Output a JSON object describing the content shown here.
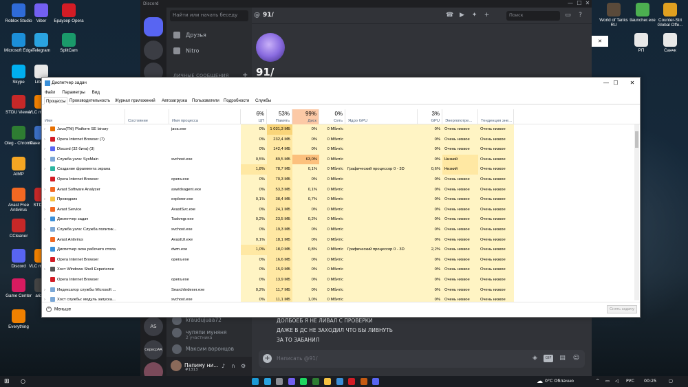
{
  "desktop": {
    "left_icons": [
      {
        "label": "Roblox Studio",
        "color": "#2f6bd8"
      },
      {
        "label": "Viber",
        "color": "#7360f2"
      },
      {
        "label": "Браузер Opera",
        "color": "#d31c25"
      },
      {
        "label": "Microsoft Edge",
        "color": "#1c8fd8"
      },
      {
        "label": "Telegram",
        "color": "#2aa3e0"
      },
      {
        "label": "SplitCam",
        "color": "#1a9a6a"
      },
      {
        "label": "Skype",
        "color": "#00aff0"
      },
      {
        "label": "LibreO",
        "color": "#e8e8e8"
      },
      {
        "label": "STDU Viewer",
        "color": "#c62828"
      },
      {
        "label": "VLC m playe",
        "color": "#f08000"
      },
      {
        "label": "Oleg - Chrome",
        "color": "#2e7d32"
      },
      {
        "label": "Пане управ",
        "color": "#3b6fc4"
      },
      {
        "label": "AIMP",
        "color": "#f5a623"
      },
      {
        "label": "Avast Free Antivirus",
        "color": "#f26822"
      },
      {
        "label": "STDU V",
        "color": "#c62828"
      },
      {
        "label": "CCleaner",
        "color": "#c62828"
      },
      {
        "label": "Discord",
        "color": "#5865f2"
      },
      {
        "label": "VLC m playe",
        "color": "#f08000"
      },
      {
        "label": "Game Center",
        "color": "#d81b60"
      },
      {
        "label": "arizon",
        "color": "#444444"
      },
      {
        "label": "Everything",
        "color": "#f08000"
      }
    ],
    "right_icons": [
      {
        "label": "World of Tanks RU",
        "color": "#5a4a3a"
      },
      {
        "label": "tlauncher.exe",
        "color": "#4caf50"
      },
      {
        "label": "Counter-Stri Global Offe...",
        "color": "#e0a020"
      },
      {
        "label": "РП",
        "color": "#e8e8e8"
      },
      {
        "label": "Санчк",
        "color": "#e8e8e8"
      }
    ],
    "popup_close": "✕"
  },
  "discord": {
    "window_title": "Discord",
    "search_placeholder": "Найти или начать беседу",
    "nav": [
      "Друзья",
      "Nitro"
    ],
    "dm_caption": "ЛИЧНЫЕ СООБЩЕНИЯ",
    "dm_add": "+",
    "servers": [
      "АS",
      "СервсрАА"
    ],
    "dms": [
      {
        "name": "kraudujuaa72",
        "sub": ""
      },
      {
        "name": "чупяпи муняня",
        "sub": "2 участника"
      },
      {
        "name": "Максим воронцов",
        "sub": ""
      }
    ],
    "user": {
      "name": "Папиму ни...",
      "tag": "#1313"
    },
    "channel_name": "91/",
    "big_name": "91/",
    "header_search": "Поиск",
    "messages": [
      "ДОЛБОЕБ Я НЕ ЛИВАЛ С ПРОВЕРКИ",
      "ДАЖЕ В ДС НЕ ЗАХОДИЛ ЧТО БЫ ЛИВНУТЬ",
      "ЗА ТО ЗАБАНИЛ"
    ],
    "input_placeholder": "Написать @91/",
    "gif_label": "GIF"
  },
  "taskmanager": {
    "title": "Диспетчер задач",
    "controls": {
      "min": "—",
      "max": "☐",
      "close": "✕"
    },
    "menu": [
      "Файл",
      "Параметры",
      "Вид"
    ],
    "tabs": [
      "Процессы",
      "Производительность",
      "Журнал приложений",
      "Автозагрузка",
      "Пользователи",
      "Подробности",
      "Службы"
    ],
    "headers": {
      "name": "Имя",
      "status": "Состояние",
      "process": "Имя процесса",
      "cpu_pct": "6%",
      "cpu": "ЦП",
      "mem_pct": "53%",
      "mem": "Память",
      "disk_pct": "99%",
      "disk": "Диск",
      "net_pct": "0%",
      "net": "Сеть",
      "gpu_engine": "Ядро GPU",
      "gpu_pct": "3%",
      "gpu": "GPU",
      "power": "Энергопотре...",
      "power_trend": "Тенденция эне..."
    },
    "rows": [
      {
        "name": "Java(TM) Platform SE binary",
        "proc": "java.exe",
        "cpu": "0%",
        "mem": "1 031,3 МБ",
        "disk": "0%",
        "net": "0 Мбит/с",
        "gpu_engine": "",
        "gpu": "0%",
        "power": "Очень низкое",
        "trend": "Очень низкое",
        "icon": "#e76f00",
        "expand": true
      },
      {
        "name": "Opera Internet Browser (7)",
        "proc": "",
        "cpu": "0%",
        "mem": "232,4 МБ",
        "disk": "0%",
        "net": "0 Мбит/с",
        "gpu_engine": "",
        "gpu": "0%",
        "power": "Очень низкое",
        "trend": "Очень низкое",
        "icon": "#d31c25",
        "expand": true
      },
      {
        "name": "Discord (32 бита) (3)",
        "proc": "",
        "cpu": "0%",
        "mem": "142,4 МБ",
        "disk": "0%",
        "net": "0 Мбит/с",
        "gpu_engine": "",
        "gpu": "0%",
        "power": "Очень низкое",
        "trend": "Очень низкое",
        "icon": "#5865f2",
        "expand": true
      },
      {
        "name": "Служба узла: SysMain",
        "proc": "svchost.exe",
        "cpu": "0,5%",
        "mem": "89,5 МБ",
        "disk": "63,0%",
        "net": "0 Мбит/с",
        "gpu_engine": "",
        "gpu": "0%",
        "power": "Низкий",
        "trend": "Очень низкое",
        "icon": "#7aa7d6",
        "expand": true
      },
      {
        "name": "Создание фрагмента экрана",
        "proc": "",
        "cpu": "1,8%",
        "mem": "78,7 МБ",
        "disk": "0,1%",
        "net": "0 Мбит/с",
        "gpu_engine": "Графический процессор 0 - 3D",
        "gpu": "0,6%",
        "power": "Низкий",
        "trend": "Очень низкое",
        "icon": "#2bb5a0",
        "expand": true
      },
      {
        "name": "Opera Internet Browser",
        "proc": "opera.exe",
        "cpu": "0%",
        "mem": "70,3 МБ",
        "disk": "0%",
        "net": "0 Мбит/с",
        "gpu_engine": "",
        "gpu": "0%",
        "power": "Очень низкое",
        "trend": "Очень низкое",
        "icon": "#d31c25",
        "expand": false
      },
      {
        "name": "Avast Software Analyzer",
        "proc": "aswidsagent.exe",
        "cpu": "0%",
        "mem": "53,3 МБ",
        "disk": "0,1%",
        "net": "0 Мбит/с",
        "gpu_engine": "",
        "gpu": "0%",
        "power": "Очень низкое",
        "trend": "Очень низкое",
        "icon": "#f26822",
        "expand": true
      },
      {
        "name": "Проводник",
        "proc": "explorer.exe",
        "cpu": "0,1%",
        "mem": "38,4 МБ",
        "disk": "0,7%",
        "net": "0 Мбит/с",
        "gpu_engine": "",
        "gpu": "0%",
        "power": "Очень низкое",
        "trend": "Очень низкое",
        "icon": "#f5c242",
        "expand": true
      },
      {
        "name": "Avast Service",
        "proc": "AvastSvc.exe",
        "cpu": "0%",
        "mem": "24,1 МБ",
        "disk": "0%",
        "net": "0 Мбит/с",
        "gpu_engine": "",
        "gpu": "0%",
        "power": "Очень низкое",
        "trend": "Очень низкое",
        "icon": "#f26822",
        "expand": true
      },
      {
        "name": "Диспетчер задач",
        "proc": "Taskmgr.exe",
        "cpu": "0,2%",
        "mem": "23,5 МБ",
        "disk": "0,2%",
        "net": "0 Мбит/с",
        "gpu_engine": "",
        "gpu": "0%",
        "power": "Очень низкое",
        "trend": "Очень низкое",
        "icon": "#3a8fd8",
        "expand": true
      },
      {
        "name": "Служба узла: Служба политик...",
        "proc": "svchost.exe",
        "cpu": "0%",
        "mem": "19,3 МБ",
        "disk": "0%",
        "net": "0 Мбит/с",
        "gpu_engine": "",
        "gpu": "0%",
        "power": "Очень низкое",
        "trend": "Очень низкое",
        "icon": "#7aa7d6",
        "expand": true
      },
      {
        "name": "Avast Antivirus",
        "proc": "AvastUI.exe",
        "cpu": "0,1%",
        "mem": "18,1 МБ",
        "disk": "0%",
        "net": "0 Мбит/с",
        "gpu_engine": "",
        "gpu": "0%",
        "power": "Очень низкое",
        "trend": "Очень низкое",
        "icon": "#f26822",
        "expand": false
      },
      {
        "name": "Диспетчер окон рабочего стола",
        "proc": "dwm.exe",
        "cpu": "1,0%",
        "mem": "18,0 МБ",
        "disk": "0,8%",
        "net": "0 Мбит/с",
        "gpu_engine": "Графический процессор 0 - 3D",
        "gpu": "2,2%",
        "power": "Очень низкое",
        "trend": "Очень низкое",
        "icon": "#3a8fd8",
        "expand": false
      },
      {
        "name": "Opera Internet Browser",
        "proc": "opera.exe",
        "cpu": "0%",
        "mem": "16,6 МБ",
        "disk": "0%",
        "net": "0 Мбит/с",
        "gpu_engine": "",
        "gpu": "0%",
        "power": "Очень низкое",
        "trend": "Очень низкое",
        "icon": "#d31c25",
        "expand": false
      },
      {
        "name": "Хост Windows Shell Experience",
        "proc": "",
        "cpu": "0%",
        "mem": "15,9 МБ",
        "disk": "0%",
        "net": "0 Мбит/с",
        "gpu_engine": "",
        "gpu": "0%",
        "power": "Очень низкое",
        "trend": "Очень низкое",
        "icon": "#555555",
        "expand": true
      },
      {
        "name": "Opera Internet Browser",
        "proc": "opera.exe",
        "cpu": "0%",
        "mem": "13,9 МБ",
        "disk": "0%",
        "net": "0 Мбит/с",
        "gpu_engine": "",
        "gpu": "0%",
        "power": "Очень низкое",
        "trend": "Очень низкое",
        "icon": "#d31c25",
        "expand": false
      },
      {
        "name": "Индексатор службы Microsoft ...",
        "proc": "SearchIndexer.exe",
        "cpu": "0,2%",
        "mem": "11,7 МБ",
        "disk": "0%",
        "net": "0 Мбит/с",
        "gpu_engine": "",
        "gpu": "0%",
        "power": "Очень низкое",
        "trend": "Очень низкое",
        "icon": "#7aa7d6",
        "expand": true
      },
      {
        "name": "Хост службы: модуль запуска...",
        "proc": "svchost.exe",
        "cpu": "0%",
        "mem": "11,1 МБ",
        "disk": "1,0%",
        "net": "0 Мбит/с",
        "gpu_engine": "",
        "gpu": "0%",
        "power": "Очень низкое",
        "trend": "Очень низкое",
        "icon": "#7aa7d6",
        "expand": true
      }
    ],
    "less_label": "Меньше",
    "end_task_label": "Снять задачу"
  },
  "taskbar": {
    "apps": [
      "#1b9ad6",
      "#2aa3e0",
      "#8c8f96",
      "#7360f2",
      "#1ed760",
      "#2e7d32",
      "#f5c242",
      "#3a8fd8",
      "#d31c25",
      "#c55a11",
      "#5865f2"
    ],
    "weather": "0°C Облачно",
    "lang": "РУС",
    "time": "00:25"
  }
}
